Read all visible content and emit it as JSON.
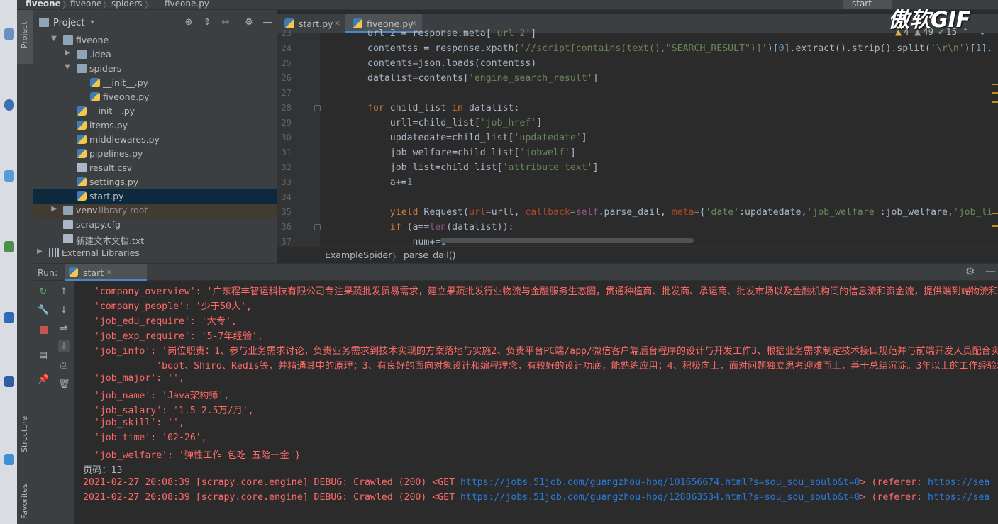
{
  "breadcrumb": [
    "fiveone",
    "fiveone",
    "spiders",
    "fiveone.py"
  ],
  "run_config": "start",
  "watermark": "傲软GIF",
  "side_tabs": {
    "project": "Project",
    "structure": "Structure",
    "favorites": "Favorites"
  },
  "project_panel": {
    "title": "Project",
    "tree": [
      {
        "label": "fiveone",
        "type": "folder",
        "depth": 0,
        "arrow": "down"
      },
      {
        "label": ".idea",
        "type": "folder",
        "depth": 1,
        "arrow": "right"
      },
      {
        "label": "spiders",
        "type": "folder",
        "depth": 1,
        "arrow": "down"
      },
      {
        "label": "__init__.py",
        "type": "py",
        "depth": 2
      },
      {
        "label": "fiveone.py",
        "type": "py",
        "depth": 2
      },
      {
        "label": "__init__.py",
        "type": "py",
        "depth": 1
      },
      {
        "label": "items.py",
        "type": "py",
        "depth": 1
      },
      {
        "label": "middlewares.py",
        "type": "py",
        "depth": 1
      },
      {
        "label": "pipelines.py",
        "type": "py",
        "depth": 1
      },
      {
        "label": "result.csv",
        "type": "file",
        "depth": 1
      },
      {
        "label": "settings.py",
        "type": "py",
        "depth": 1
      },
      {
        "label": "start.py",
        "type": "py",
        "depth": 1,
        "selected": true
      },
      {
        "label": "venv",
        "type": "folder",
        "depth": 0,
        "arrow": "right",
        "note": "library root"
      },
      {
        "label": "scrapy.cfg",
        "type": "file",
        "depth": 0
      },
      {
        "label": "新建文本文档.txt",
        "type": "file",
        "depth": 0
      },
      {
        "label": "External Libraries",
        "type": "lib",
        "depth": -1,
        "arrow": "right"
      }
    ]
  },
  "editor": {
    "tabs": [
      {
        "label": "start.py",
        "active": false
      },
      {
        "label": "fiveone.py",
        "active": true
      }
    ],
    "close_glyph": "×",
    "inspections": {
      "warnings": "4",
      "weak": "49",
      "ok": "15"
    },
    "line_numbers": [
      "23",
      "24",
      "25",
      "26",
      "27",
      "28",
      "29",
      "30",
      "31",
      "32",
      "33",
      "34",
      "35",
      "36",
      "37"
    ],
    "breadcrumb": [
      "ExampleSpider",
      "parse_dail()"
    ]
  },
  "run_panel": {
    "label": "Run:",
    "tab": "start",
    "console": {
      "company_overview": "  'company_overview': '广东程丰智运科技有限公司专注果蔬批发贸易需求，建立果蔬批发行业物流与金融服务生态圈，贯通种植商、批发商、承运商、批发市场以及金融机构间的信息流和资金流，提供端到端物流和金融",
      "company_people": "  'company_people': '少于50人',",
      "job_edu_require": "  'job_edu_require': '大专',",
      "job_exp_require": "  'job_exp_require': '5-7年经验',",
      "job_info_1": "  'job_info': '岗位职责：1、参与业务需求讨论，负责业务需求到技术实现的方案落地与实施2、负责平台PC端/app/微信客户端后台程序的设计与开发工作3、根据业务需求制定技术接口规范并与前端开发人员配合实现相",
      "job_info_2": "             'boot、Shiro、Redis等，并精通其中的原理；3、有良好的面向对象设计和编程理念，有较好的设计功底，能熟练应用；4、积极向上，面对问题独立思考迎难而上，善于总结沉淀。3年以上的工作经验才",
      "job_major": "  'job_major': '',",
      "job_name": "  'job_name': 'Java架构师',",
      "job_salary": "  'job_salary': '1.5-2.5万/月',",
      "job_skill": "  'job_skill': '',",
      "job_time": "  'job_time': '02-26',",
      "job_welfare": "  'job_welfare': '弹性工作 包吃 五险一金'}",
      "page_line": "页码：13",
      "log1_prefix": "2021-02-27 20:08:39 [scrapy.core.engine] DEBUG: Crawled (200) <GET ",
      "log1_url": "https://jobs.51job.com/guangzhou-hpq/101656674.html?s=sou_sou_soulb&t=0",
      "log1_suffix": "> (referer: ",
      "log1_ref": "https://sea",
      "log2_prefix": "2021-02-27 20:08:39 [scrapy.core.engine] DEBUG: Crawled (200) <GET ",
      "log2_url": "https://jobs.51job.com/guangzhou-hpq/128863534.html?s=sou_sou_soulb&t=0",
      "log2_suffix": "> (referer: ",
      "log2_ref": "https://sea"
    }
  }
}
